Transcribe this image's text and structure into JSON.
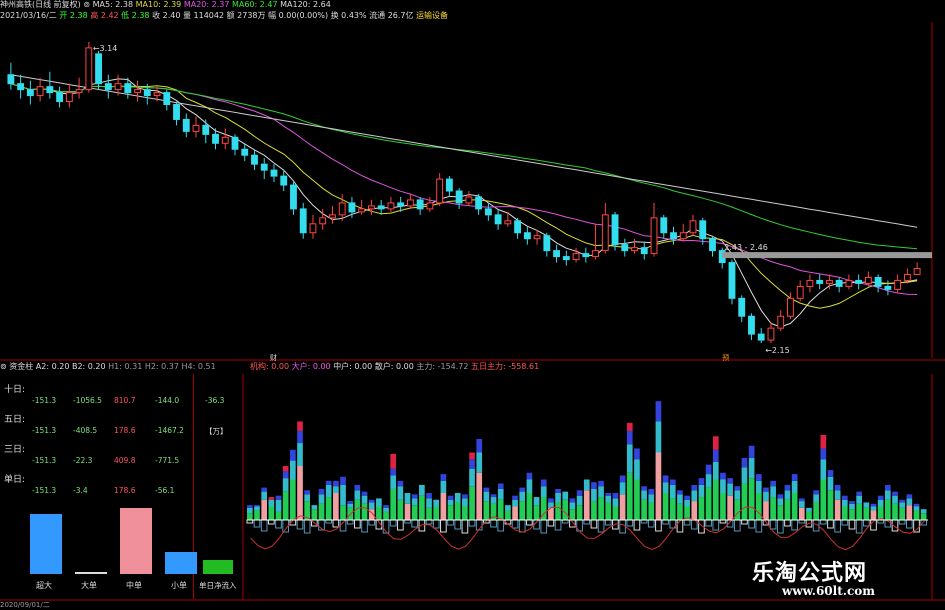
{
  "header": {
    "stock_name": "神州高铁",
    "period": "(日线 前复权)",
    "ma_labels": [
      {
        "text": "MA5: 2.38",
        "color": "#dddddd"
      },
      {
        "text": "MA10: 2.39",
        "color": "#dddd33"
      },
      {
        "text": "MA20: 2.37",
        "color": "#ee55ee"
      },
      {
        "text": "MA60: 2.47",
        "color": "#33ee33"
      },
      {
        "text": "MA120: 2.64",
        "color": "#dddddd"
      }
    ],
    "quote_line": {
      "date": "2021/03/16/二",
      "open": "开 2.38",
      "high": "高 2.42",
      "low": "低 2.38",
      "close": "收 2.40",
      "volume": "量 114042",
      "amount": "额 2738万",
      "change": "幅 0.00(0.00%)",
      "turnover": "换 0.43%",
      "float": "流通 26.7亿",
      "sector": "运输设备"
    }
  },
  "chart_data": {
    "type": "candlestick",
    "annotations": {
      "high_label": "3.14",
      "low_label": "2.15",
      "range_label": "2.43 - 2.46",
      "event_marker_1": "财",
      "event_marker_2": "预"
    },
    "candles": [
      [
        3.05,
        3.02,
        3.09,
        3.0
      ],
      [
        3.02,
        3.0,
        3.05,
        2.97
      ],
      [
        3.0,
        2.98,
        3.03,
        2.95
      ],
      [
        2.98,
        3.01,
        3.04,
        2.96
      ],
      [
        3.01,
        2.99,
        3.06,
        2.97
      ],
      [
        2.99,
        2.96,
        3.01,
        2.94
      ],
      [
        2.96,
        2.99,
        3.02,
        2.94
      ],
      [
        2.99,
        3.0,
        3.04,
        2.97
      ],
      [
        3.0,
        3.14,
        3.16,
        2.99
      ],
      [
        3.12,
        3.02,
        3.13,
        3.0
      ],
      [
        3.02,
        3.0,
        3.05,
        2.97
      ],
      [
        3.0,
        3.02,
        3.05,
        2.98
      ],
      [
        3.02,
        2.99,
        3.04,
        2.97
      ],
      [
        2.99,
        3.0,
        3.03,
        2.96
      ],
      [
        3.0,
        2.98,
        3.02,
        2.95
      ],
      [
        2.98,
        2.99,
        3.01,
        2.96
      ],
      [
        2.99,
        2.95,
        3.0,
        2.93
      ],
      [
        2.95,
        2.9,
        2.96,
        2.88
      ],
      [
        2.9,
        2.86,
        2.92,
        2.84
      ],
      [
        2.86,
        2.88,
        2.91,
        2.84
      ],
      [
        2.88,
        2.85,
        2.9,
        2.82
      ],
      [
        2.85,
        2.82,
        2.87,
        2.8
      ],
      [
        2.82,
        2.84,
        2.87,
        2.8
      ],
      [
        2.84,
        2.8,
        2.85,
        2.78
      ],
      [
        2.8,
        2.78,
        2.82,
        2.76
      ],
      [
        2.78,
        2.75,
        2.8,
        2.73
      ],
      [
        2.75,
        2.73,
        2.77,
        2.7
      ],
      [
        2.73,
        2.71,
        2.75,
        2.69
      ],
      [
        2.71,
        2.68,
        2.73,
        2.66
      ],
      [
        2.68,
        2.6,
        2.69,
        2.58
      ],
      [
        2.6,
        2.52,
        2.62,
        2.5
      ],
      [
        2.52,
        2.55,
        2.58,
        2.5
      ],
      [
        2.55,
        2.57,
        2.6,
        2.53
      ],
      [
        2.57,
        2.58,
        2.61,
        2.55
      ],
      [
        2.58,
        2.62,
        2.65,
        2.56
      ],
      [
        2.62,
        2.59,
        2.64,
        2.57
      ],
      [
        2.59,
        2.6,
        2.63,
        2.58
      ],
      [
        2.6,
        2.61,
        2.63,
        2.58
      ],
      [
        2.61,
        2.6,
        2.63,
        2.58
      ],
      [
        2.6,
        2.62,
        2.64,
        2.59
      ],
      [
        2.62,
        2.61,
        2.64,
        2.59
      ],
      [
        2.61,
        2.63,
        2.65,
        2.6
      ],
      [
        2.63,
        2.6,
        2.64,
        2.58
      ],
      [
        2.6,
        2.62,
        2.64,
        2.59
      ],
      [
        2.62,
        2.7,
        2.72,
        2.61
      ],
      [
        2.7,
        2.66,
        2.71,
        2.64
      ],
      [
        2.66,
        2.62,
        2.67,
        2.6
      ],
      [
        2.62,
        2.64,
        2.66,
        2.61
      ],
      [
        2.64,
        2.6,
        2.65,
        2.58
      ],
      [
        2.6,
        2.58,
        2.62,
        2.56
      ],
      [
        2.58,
        2.55,
        2.6,
        2.53
      ],
      [
        2.55,
        2.56,
        2.59,
        2.54
      ],
      [
        2.56,
        2.52,
        2.57,
        2.5
      ],
      [
        2.52,
        2.5,
        2.54,
        2.48
      ],
      [
        2.5,
        2.51,
        2.53,
        2.48
      ],
      [
        2.51,
        2.46,
        2.52,
        2.44
      ],
      [
        2.46,
        2.44,
        2.48,
        2.42
      ],
      [
        2.44,
        2.43,
        2.46,
        2.41
      ],
      [
        2.43,
        2.45,
        2.47,
        2.42
      ],
      [
        2.45,
        2.44,
        2.47,
        2.42
      ],
      [
        2.44,
        2.46,
        2.55,
        2.43
      ],
      [
        2.46,
        2.58,
        2.62,
        2.45
      ],
      [
        2.58,
        2.48,
        2.59,
        2.46
      ],
      [
        2.48,
        2.46,
        2.5,
        2.44
      ],
      [
        2.46,
        2.47,
        2.5,
        2.45
      ],
      [
        2.47,
        2.45,
        2.49,
        2.43
      ],
      [
        2.45,
        2.57,
        2.62,
        2.44
      ],
      [
        2.57,
        2.52,
        2.58,
        2.5
      ],
      [
        2.52,
        2.5,
        2.54,
        2.48
      ],
      [
        2.5,
        2.52,
        2.55,
        2.49
      ],
      [
        2.52,
        2.56,
        2.58,
        2.51
      ],
      [
        2.56,
        2.5,
        2.57,
        2.48
      ],
      [
        2.5,
        2.46,
        2.51,
        2.44
      ],
      [
        2.46,
        2.42,
        2.47,
        2.4
      ],
      [
        2.42,
        2.3,
        2.43,
        2.28
      ],
      [
        2.3,
        2.24,
        2.31,
        2.22
      ],
      [
        2.24,
        2.18,
        2.25,
        2.16
      ],
      [
        2.18,
        2.16,
        2.2,
        2.15
      ],
      [
        2.16,
        2.2,
        2.22,
        2.15
      ],
      [
        2.2,
        2.24,
        2.26,
        2.19
      ],
      [
        2.24,
        2.3,
        2.32,
        2.23
      ],
      [
        2.3,
        2.34,
        2.36,
        2.29
      ],
      [
        2.34,
        2.36,
        2.38,
        2.32
      ],
      [
        2.36,
        2.35,
        2.38,
        2.33
      ],
      [
        2.35,
        2.36,
        2.38,
        2.33
      ],
      [
        2.36,
        2.34,
        2.37,
        2.32
      ],
      [
        2.34,
        2.36,
        2.38,
        2.33
      ],
      [
        2.36,
        2.35,
        2.38,
        2.33
      ],
      [
        2.35,
        2.37,
        2.39,
        2.34
      ],
      [
        2.37,
        2.34,
        2.38,
        2.32
      ],
      [
        2.34,
        2.33,
        2.36,
        2.31
      ],
      [
        2.33,
        2.36,
        2.38,
        2.32
      ],
      [
        2.36,
        2.38,
        2.4,
        2.35
      ],
      [
        2.38,
        2.4,
        2.42,
        2.38
      ]
    ],
    "ylim": [
      2.12,
      3.2
    ]
  },
  "lower": {
    "indicator_name": "资金柱",
    "params": [
      {
        "text": "A2: 0.20",
        "color": "#dddddd"
      },
      {
        "text": "B2: 0.20",
        "color": "#dddddd"
      },
      {
        "text": "H1: 0.31",
        "color": "#999999"
      },
      {
        "text": "H2: 0.37",
        "color": "#999999"
      },
      {
        "text": "H4: 0.51",
        "color": "#999999"
      }
    ],
    "flows": [
      {
        "text": "机构: 0.00",
        "color": "#ff5555"
      },
      {
        "text": "大户: 0.00",
        "color": "#ee55ee"
      },
      {
        "text": "中户: 0.00",
        "color": "#dddddd"
      },
      {
        "text": "散户: 0.00",
        "color": "#dddddd"
      },
      {
        "text": "主力: -154.72",
        "color": "#999999"
      },
      {
        "text": "五日主力: -558.61",
        "color": "#ff5555"
      }
    ],
    "left_table": {
      "rows": [
        {
          "label": "十日:",
          "vals": [
            "-151.3",
            "-1056.5",
            "810.7",
            "-144.0"
          ],
          "extra": "-36.3"
        },
        {
          "label": "五日:",
          "vals": [
            "-151.3",
            "-408.5",
            "178.6",
            "-1467.2"
          ],
          "extra": "【万】"
        },
        {
          "label": "三日:",
          "vals": [
            "-151.3",
            "-22.3",
            "409.8",
            "-771.5"
          ],
          "extra": ""
        },
        {
          "label": "单日:",
          "vals": [
            "-151.3",
            "-3.4",
            "178.6",
            "-56.1"
          ],
          "extra": ""
        }
      ],
      "bars": [
        {
          "label": "超大",
          "color": "#3399ff",
          "value": 60
        },
        {
          "label": "大单",
          "color": "#dddddd",
          "value": 2
        },
        {
          "label": "中单",
          "color": "#f0909a",
          "value": 66
        },
        {
          "label": "小单",
          "color": "#3399ff",
          "value": 22
        }
      ],
      "net_label": "单日净流入",
      "net_color": "#22bb22"
    },
    "flow_bars": [
      [
        10,
        8,
        4,
        0
      ],
      [
        14,
        6,
        2,
        0
      ],
      [
        30,
        12,
        6,
        0
      ],
      [
        20,
        10,
        0,
        4
      ],
      [
        12,
        18,
        6,
        0
      ],
      [
        42,
        20,
        10,
        8
      ],
      [
        60,
        28,
        16,
        0
      ],
      [
        80,
        34,
        18,
        14
      ],
      [
        28,
        10,
        6,
        0
      ],
      [
        16,
        6,
        0,
        0
      ],
      [
        24,
        14,
        8,
        0
      ],
      [
        34,
        18,
        6,
        0
      ],
      [
        40,
        10,
        8,
        0
      ],
      [
        22,
        30,
        12,
        0
      ],
      [
        18,
        6,
        4,
        0
      ],
      [
        30,
        14,
        8,
        0
      ],
      [
        24,
        12,
        6,
        0
      ],
      [
        16,
        10,
        4,
        0
      ],
      [
        20,
        12,
        0,
        0
      ],
      [
        12,
        6,
        4,
        0
      ],
      [
        46,
        20,
        10,
        22
      ],
      [
        30,
        20,
        8,
        0
      ],
      [
        24,
        16,
        0,
        0
      ],
      [
        22,
        10,
        6,
        0
      ],
      [
        36,
        16,
        0,
        0
      ],
      [
        18,
        14,
        8,
        0
      ],
      [
        20,
        10,
        0,
        0
      ],
      [
        40,
        18,
        10,
        0
      ],
      [
        22,
        8,
        6,
        0
      ],
      [
        26,
        14,
        0,
        0
      ],
      [
        20,
        12,
        6,
        0
      ],
      [
        50,
        26,
        14,
        10
      ],
      [
        70,
        30,
        20,
        0
      ],
      [
        28,
        14,
        6,
        0
      ],
      [
        24,
        10,
        4,
        0
      ],
      [
        30,
        16,
        8,
        0
      ],
      [
        14,
        8,
        0,
        0
      ],
      [
        20,
        10,
        6,
        0
      ],
      [
        28,
        14,
        6,
        0
      ],
      [
        40,
        20,
        10,
        0
      ],
      [
        22,
        12,
        0,
        0
      ],
      [
        34,
        16,
        10,
        0
      ],
      [
        18,
        8,
        6,
        0
      ],
      [
        26,
        14,
        6,
        0
      ],
      [
        30,
        12,
        0,
        0
      ],
      [
        16,
        10,
        6,
        0
      ],
      [
        22,
        14,
        8,
        0
      ],
      [
        44,
        16,
        0,
        0
      ],
      [
        28,
        18,
        10,
        0
      ],
      [
        34,
        16,
        8,
        0
      ],
      [
        26,
        10,
        4,
        0
      ],
      [
        20,
        12,
        8,
        0
      ],
      [
        38,
        18,
        10,
        0
      ],
      [
        70,
        42,
        20,
        12
      ],
      [
        60,
        30,
        16,
        0
      ],
      [
        30,
        14,
        6,
        0
      ],
      [
        26,
        12,
        8,
        0
      ],
      [
        100,
        46,
        30,
        0
      ],
      [
        40,
        16,
        10,
        0
      ],
      [
        32,
        20,
        8,
        0
      ],
      [
        24,
        14,
        6,
        0
      ],
      [
        20,
        10,
        6,
        0
      ],
      [
        28,
        16,
        8,
        0
      ],
      [
        34,
        18,
        10,
        0
      ],
      [
        48,
        20,
        14,
        0
      ],
      [
        60,
        26,
        18,
        20
      ],
      [
        40,
        20,
        10,
        0
      ],
      [
        36,
        18,
        8,
        0
      ],
      [
        30,
        14,
        6,
        0
      ],
      [
        54,
        24,
        14,
        0
      ],
      [
        62,
        30,
        18,
        0
      ],
      [
        40,
        18,
        10,
        0
      ],
      [
        28,
        14,
        6,
        0
      ],
      [
        34,
        16,
        8,
        0
      ],
      [
        22,
        10,
        6,
        0
      ],
      [
        30,
        14,
        8,
        0
      ],
      [
        40,
        18,
        10,
        0
      ],
      [
        18,
        10,
        4,
        0
      ],
      [
        12,
        6,
        0,
        0
      ],
      [
        26,
        12,
        6,
        0
      ],
      [
        60,
        30,
        16,
        20
      ],
      [
        44,
        20,
        10,
        0
      ],
      [
        30,
        14,
        8,
        0
      ],
      [
        20,
        10,
        6,
        0
      ],
      [
        16,
        8,
        4,
        0
      ],
      [
        24,
        12,
        6,
        0
      ],
      [
        18,
        8,
        0,
        0
      ],
      [
        14,
        6,
        4,
        0
      ],
      [
        20,
        10,
        6,
        0
      ],
      [
        30,
        14,
        8,
        0
      ],
      [
        24,
        12,
        6,
        0
      ],
      [
        18,
        8,
        4,
        0
      ],
      [
        22,
        10,
        6,
        0
      ],
      [
        14,
        6,
        4,
        0
      ],
      [
        10,
        6,
        0,
        0
      ]
    ]
  },
  "watermark": {
    "brand": "乐淘公式网",
    "url": "www.60lt.com"
  },
  "footer": {
    "date": "2020/09/01/二"
  }
}
